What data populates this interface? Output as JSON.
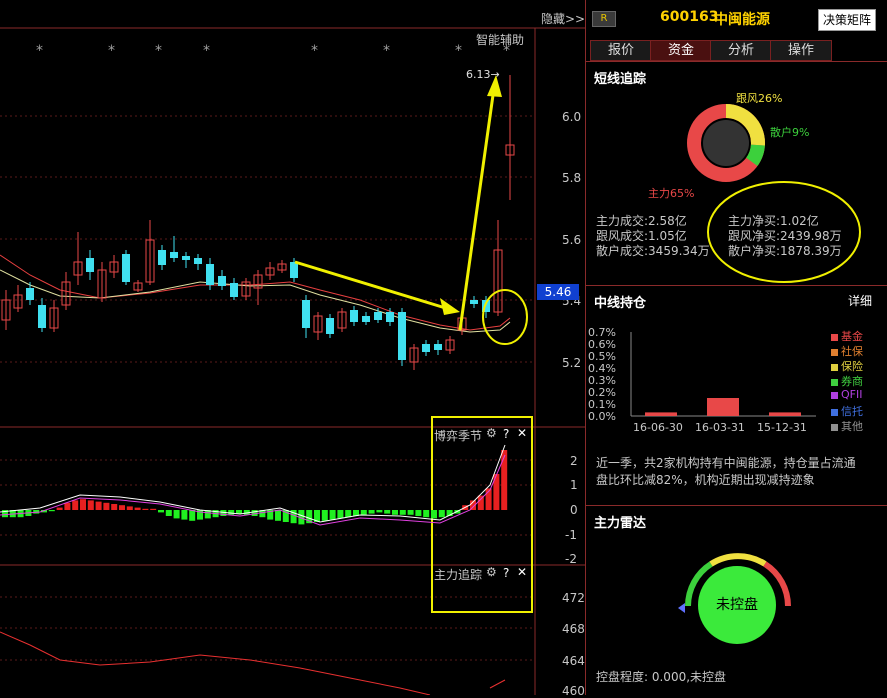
{
  "toolbar": {
    "hide_label": "隐藏>>",
    "assist_label": "智能辅助",
    "price_tag": "5.46",
    "high_label": "6.13→"
  },
  "price_axis": [
    "6.0",
    "5.8",
    "5.6",
    "5.4",
    "5.2"
  ],
  "indicator1": {
    "title": "博弈季节",
    "axis": [
      "2",
      "1",
      "0",
      "-1",
      "-2"
    ]
  },
  "indicator2": {
    "title": "主力追踪",
    "axis": [
      "472",
      "468",
      "464",
      "460"
    ]
  },
  "header": {
    "badge": "R",
    "code": "600163",
    "name": "中闽能源",
    "button": "决策矩阵"
  },
  "tabs": [
    "报价",
    "资金",
    "分析",
    "操作"
  ],
  "short_track": {
    "title": "短线追踪",
    "donut": {
      "main_label": "主力65%",
      "follow_label": "跟风26%",
      "retail_label": "散户9%",
      "colors": {
        "main": "#e84848",
        "follow": "#f0e040",
        "retail": "#3cd03c"
      }
    },
    "stats": {
      "main_deal": "主力成交:2.58亿",
      "follow_deal": "跟风成交:1.05亿",
      "retail_deal": "散户成交:3459.34万",
      "main_net": "主力净买:1.02亿",
      "follow_net": "跟风净买:2439.98万",
      "retail_net": "散户净买:1878.39万"
    }
  },
  "mid_hold": {
    "title": "中线持仓",
    "detail": "详细",
    "y_ticks": [
      "0.7%",
      "0.6%",
      "0.5%",
      "0.4%",
      "0.3%",
      "0.2%",
      "0.1%",
      "0.0%"
    ],
    "x_ticks": [
      "16-06-30",
      "16-03-31",
      "15-12-31"
    ],
    "legend": [
      {
        "label": "基金",
        "color": "#e84848"
      },
      {
        "label": "社保",
        "color": "#e08030"
      },
      {
        "label": "保险",
        "color": "#e0d040"
      },
      {
        "label": "券商",
        "color": "#40d040"
      },
      {
        "label": "QFII",
        "color": "#b040e0"
      },
      {
        "label": "信托",
        "color": "#4070e0"
      },
      {
        "label": "其他",
        "color": "#909090"
      }
    ],
    "desc1": "近一季，共2家机构持有中闽能源，持仓量占流通",
    "desc2": "盘比环比减82%，机构近期出现减持迹象"
  },
  "radar": {
    "title": "主力雷达",
    "center": "未控盘",
    "footer": "控盘程度: 0.000,未控盘"
  },
  "chart_data": [
    {
      "type": "bar",
      "categories": [
        "16-06-30",
        "16-03-31",
        "15-12-31"
      ],
      "values": [
        0.03,
        0.15,
        0.03
      ],
      "ylabel": "",
      "ylim": [
        0,
        0.7
      ]
    }
  ]
}
